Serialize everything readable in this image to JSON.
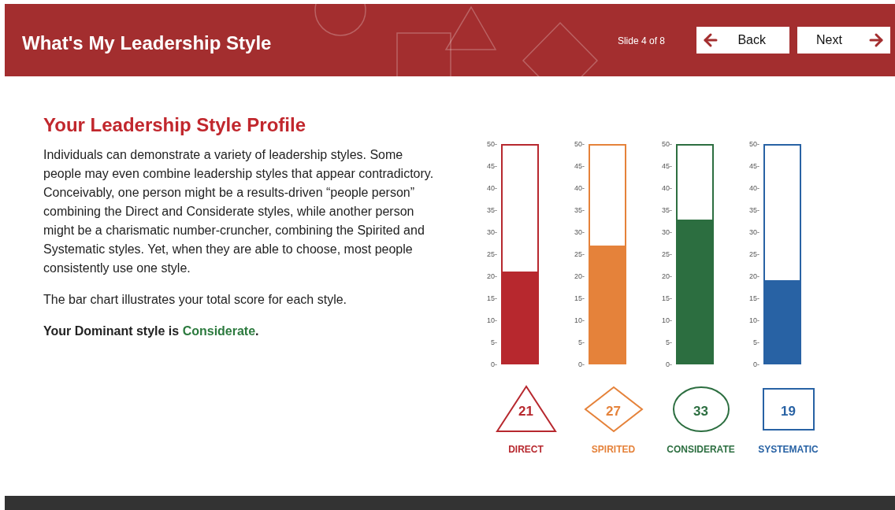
{
  "header": {
    "title": "What's My Leadership Style",
    "slide_counter": "Slide 4 of 8",
    "back_button": "Back",
    "next_button": "Next"
  },
  "content": {
    "heading": "Your Leadership Style Profile",
    "paragraphs": [
      "Individuals can demonstrate a variety of leadership styles. Some people may even combine leadership styles that appear contradictory. Conceivably, one person might be a results-driven “people person” combining the Direct and Considerate styles, while another person might be a charismatic number-cruncher, combining the Spirited and Systematic styles. Yet, when they are able to choose, most people consistently use one style.",
      "The bar chart illustrates your total score for each style."
    ],
    "dominant": {
      "before": "Your Dominant style is ",
      "style": "Considerate",
      "after": "."
    }
  },
  "styles": [
    {
      "kind": "triangle",
      "color": "#b7282e",
      "level": 0.42,
      "score": "21",
      "label": "DIRECT",
      "ticks": [
        "50-",
        "45-",
        "40-",
        "35-",
        "30-",
        "25-",
        "20-",
        "15-",
        "10-",
        "5-",
        "0-"
      ]
    },
    {
      "kind": "diamond",
      "color": "#e5823a",
      "level": 0.54,
      "score": "27",
      "label": "SPIRITED",
      "ticks": [
        "50-",
        "45-",
        "40-",
        "35-",
        "30-",
        "25-",
        "20-",
        "15-",
        "10-",
        "5-",
        "0-"
      ]
    },
    {
      "kind": "ellipse",
      "color": "#2c6e40",
      "level": 0.66,
      "score": "33",
      "label": "CONSIDERATE",
      "ticks": [
        "50-",
        "45-",
        "40-",
        "35-",
        "30-",
        "25-",
        "20-",
        "15-",
        "10-",
        "5-",
        "0-"
      ]
    },
    {
      "kind": "square",
      "color": "#2862a4",
      "level": 0.38,
      "score": "19",
      "label": "SYSTEMATIC",
      "ticks": [
        "50-",
        "45-",
        "40-",
        "35-",
        "30-",
        "25-",
        "20-",
        "15-",
        "10-",
        "5-",
        "0-"
      ]
    }
  ]
}
